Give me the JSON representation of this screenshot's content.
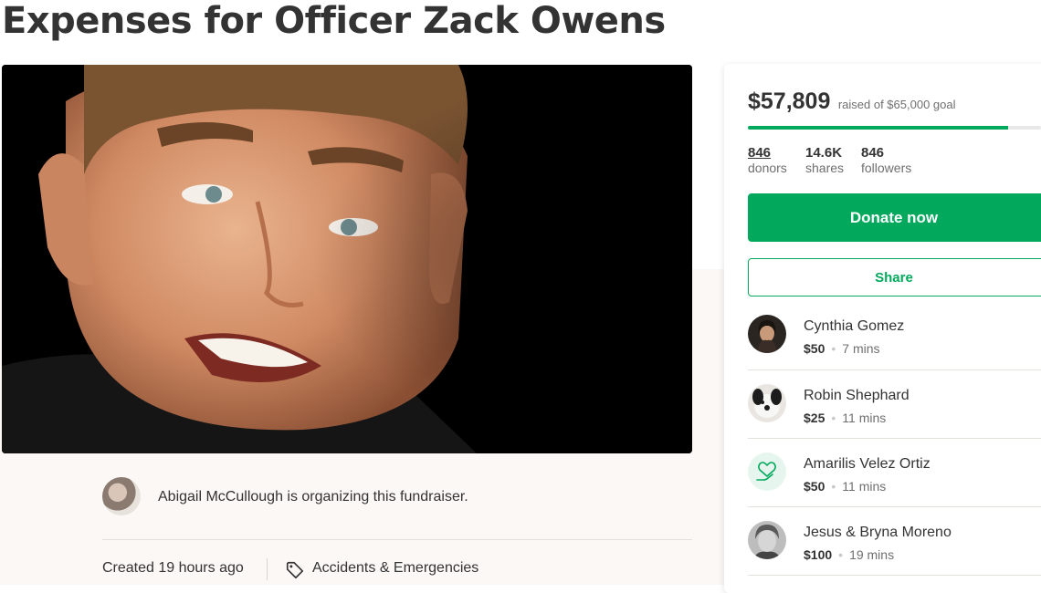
{
  "page": {
    "title": "Expenses for Officer Zack Owens"
  },
  "organizer": {
    "text": "Abigail McCullough is organizing this fundraiser."
  },
  "meta": {
    "created": "Created 19 hours ago",
    "category": "Accidents & Emergencies"
  },
  "summary": {
    "raised": "$57,809",
    "goal_text": "raised of $65,000 goal",
    "progress_fraction": 0.889,
    "stats": [
      {
        "value": "846",
        "label": "donors"
      },
      {
        "value": "14.6K",
        "label": "shares"
      },
      {
        "value": "846",
        "label": "followers"
      }
    ]
  },
  "actions": {
    "donate_label": "Donate now",
    "share_label": "Share"
  },
  "donors": [
    {
      "name": "Cynthia Gomez",
      "amount": "$50",
      "time": "7 mins",
      "avatar": "photo"
    },
    {
      "name": "Robin Shephard",
      "amount": "$25",
      "time": "11 mins",
      "avatar": "photo-dog"
    },
    {
      "name": "Amarilis Velez Ortiz",
      "amount": "$50",
      "time": "11 mins",
      "avatar": "heart-hand-icon"
    },
    {
      "name": "Jesus & Bryna Moreno",
      "amount": "$100",
      "time": "19 mins",
      "avatar": "photo"
    }
  ],
  "colors": {
    "accent": "#02a95c",
    "text": "#333333",
    "muted": "#6f6f6f"
  }
}
